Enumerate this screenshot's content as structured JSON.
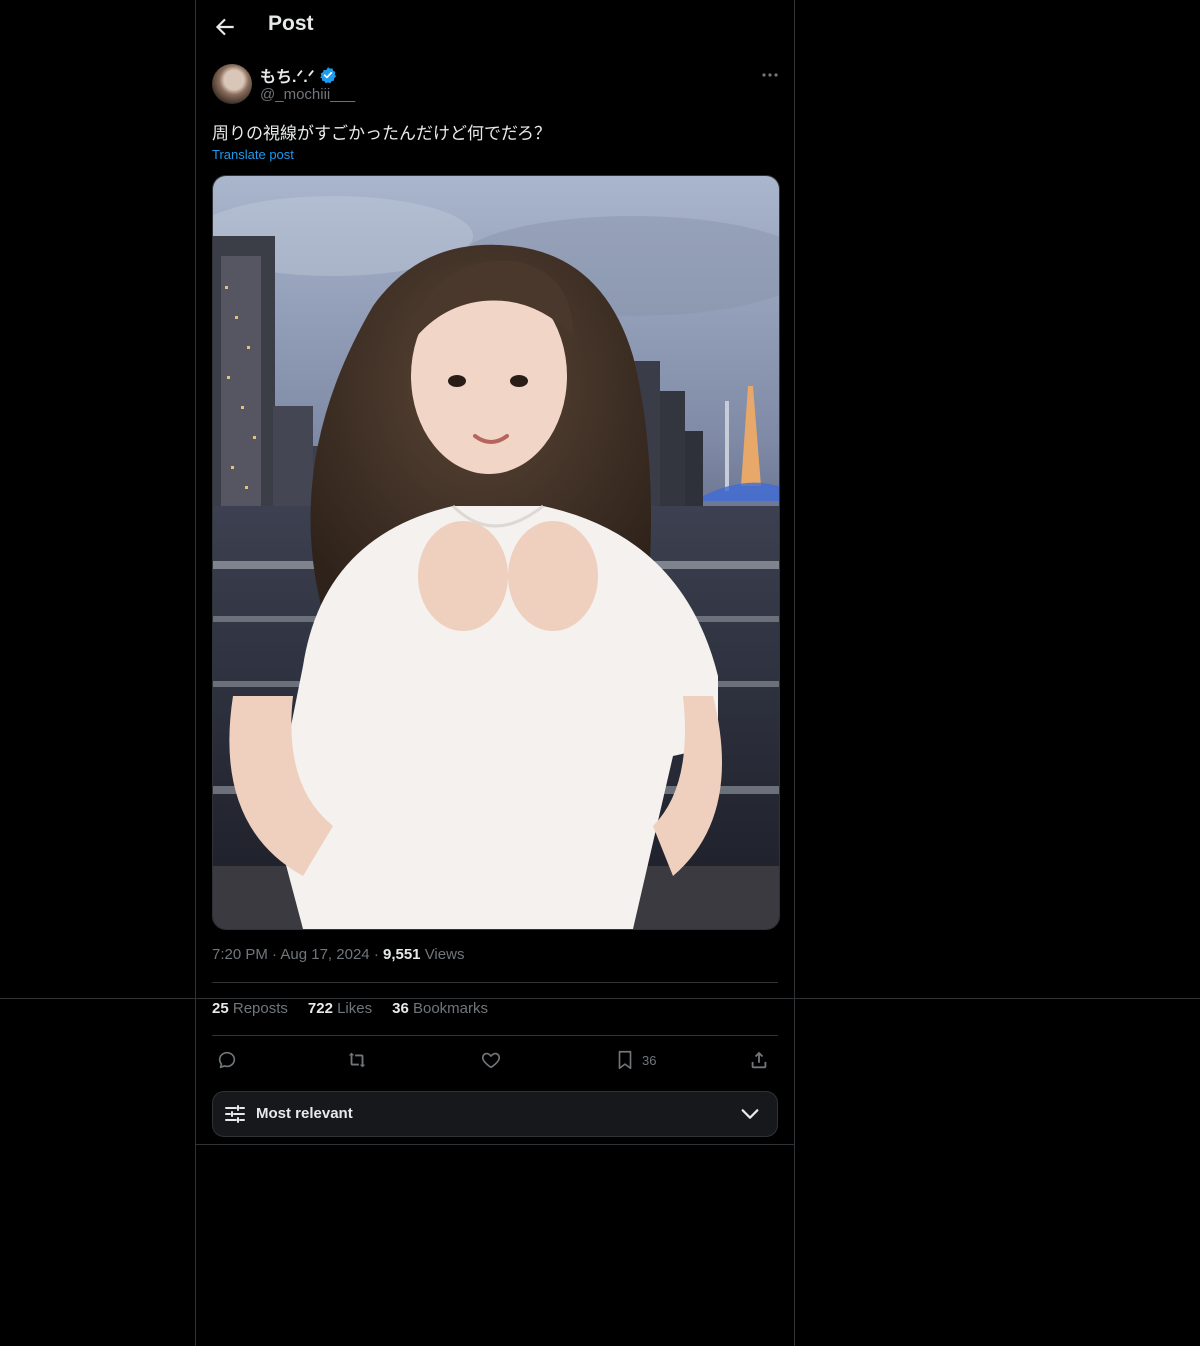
{
  "header": {
    "title": "Post"
  },
  "author": {
    "name": "もち.ᐟ.ᐟ",
    "handle": "@_mochiii___",
    "verified": true
  },
  "post": {
    "text": "周りの視線がすごかったんだけど何でだろ？",
    "translate_label": "Translate post",
    "time": "7:20 PM",
    "date": "Aug 17, 2024",
    "views_count": "9,551",
    "views_label": "Views"
  },
  "stats": {
    "reposts_count": "25",
    "reposts_label": "Reposts",
    "likes_count": "722",
    "likes_label": "Likes",
    "bookmarks_count": "36",
    "bookmarks_label": "Bookmarks"
  },
  "actions": {
    "bookmark_count": "36",
    "icons": [
      "reply-icon",
      "repost-icon",
      "like-icon",
      "bookmark-icon",
      "share-icon"
    ]
  },
  "sort": {
    "label": "Most relevant"
  },
  "colors": {
    "accent": "#1d9bf0",
    "background": "#000000",
    "border": "#2f3336",
    "muted": "#71767b"
  }
}
